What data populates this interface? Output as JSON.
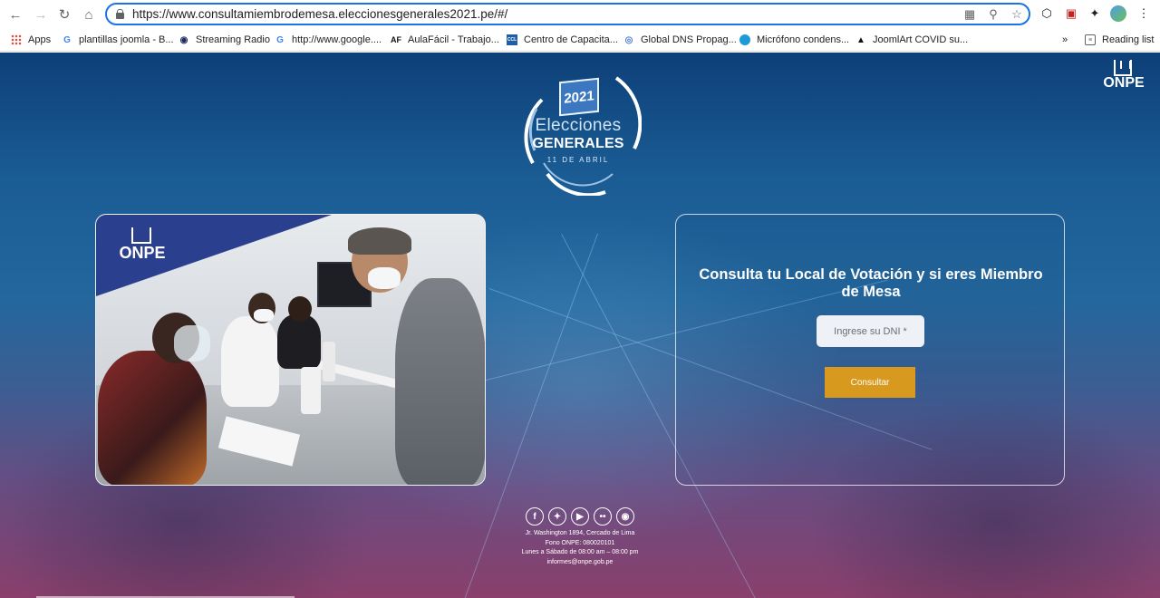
{
  "browser": {
    "url": "https://www.consultamiembrodemesa.eleccionesgenerales2021.pe/#/",
    "bookmarks": [
      {
        "label": "Apps",
        "icon": "apps-grid-icon"
      },
      {
        "label": "plantillas joomla - B...",
        "icon": "google-g-icon"
      },
      {
        "label": "Streaming Radio",
        "icon": "radio-icon"
      },
      {
        "label": "http://www.google....",
        "icon": "google-g-icon"
      },
      {
        "label": "AulaFácil - Trabajo...",
        "icon": "af-icon"
      },
      {
        "label": "Centro de Capacita...",
        "icon": "ccl-icon"
      },
      {
        "label": "Global DNS Propag...",
        "icon": "dns-icon"
      },
      {
        "label": "Micrófono condens...",
        "icon": "dot-icon"
      },
      {
        "label": "JoomlArt COVID su...",
        "icon": "joomlart-icon"
      }
    ],
    "more_bookmarks": "»",
    "reading_list": "Reading list"
  },
  "logo": {
    "year": "2021",
    "line1": "Elecciones",
    "line2": "GENERALES",
    "date": "11 DE ABRIL"
  },
  "brand": "ONPE",
  "form": {
    "title": "Consulta tu Local de Votación y si eres Miembro de Mesa",
    "dni_placeholder": "Ingrese su DNI *",
    "dni_value": "",
    "submit_label": "Consultar",
    "accent_color": "#d79a1e"
  },
  "footer": {
    "socials": [
      "facebook-icon",
      "twitter-icon",
      "youtube-icon",
      "flickr-icon",
      "instagram-icon"
    ],
    "address": "Jr. Washington 1894, Cercado de Lima",
    "phone": "Fono ONPE: 080020101",
    "hours": "Lunes a Sábado de 08:00 am – 08:00 pm",
    "email": "informes@onpe.gob.pe"
  }
}
